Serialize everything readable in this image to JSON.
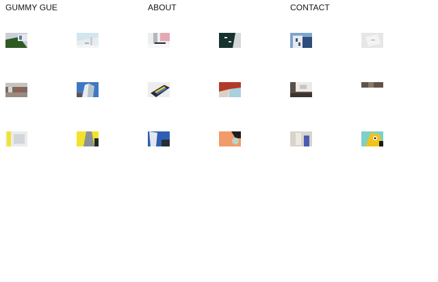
{
  "header": {
    "brand": "GUMMY GUE",
    "nav": [
      {
        "id": "about",
        "label": "ABOUT"
      },
      {
        "id": "contact",
        "label": "CONTACT"
      }
    ]
  },
  "gallery": {
    "count": 18,
    "colors": {
      "accent_yellow": "#f2e32a",
      "accent_orange": "#f29a6a",
      "accent_blue": "#2f5fb3",
      "accent_red": "#b23a2a",
      "dark_teal": "#17322f"
    }
  }
}
